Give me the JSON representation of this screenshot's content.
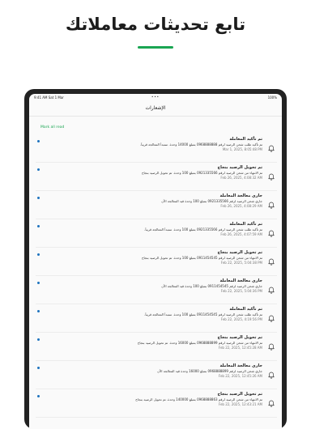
{
  "headline": "تابع تحديثات معاملاتك",
  "colors": {
    "accent": "#1aa552",
    "unread_dot": "#1e73be"
  },
  "status_bar": {
    "time": "9:41 AM",
    "date": "Sat 1 Mar",
    "dots": "•••",
    "battery": "100%"
  },
  "nav": {
    "title": "الإشعارات"
  },
  "mark_all_read": "Mark all read",
  "notifications": [
    {
      "title": "تم تأكيد المعاملة",
      "body": "تم تأكيد طلب شحن الرصيد لرقم 0968888888 بمبلغ 14000 وحدة. ستبدأ المعالجة قريباً.",
      "date": "Mar 1, 2025, 8:05:48 PM",
      "icon": "bell-icon"
    },
    {
      "title": "تم تحويل الرصيد بنجاح",
      "body": "تم الانتهاء من شحن الرصيد لرقم 0921335566 بمبلغ 100 وحدة. تم تحويل الرصيد بنجاح",
      "date": "Feb 26, 2025, 4:08:32 AM",
      "icon": "bell-icon"
    },
    {
      "title": "جاري معالجة المعاملة",
      "body": "جاري شحن الرصيد لرقم 0921335566 بمبلغ 100 وحدة قيد المعالجة الآن",
      "date": "Feb 26, 2025, 4:08:29 AM",
      "icon": "bell-icon"
    },
    {
      "title": "تم تأكيد المعاملة",
      "body": "تم تأكيد طلب شحن الرصيد لرقم 0921335566 بمبلغ 100 وحدة. ستبدأ المعالجة قريباً.",
      "date": "Feb 26, 2025, 4:07:59 AM",
      "icon": "bell-icon"
    },
    {
      "title": "تم تحويل الرصيد بنجاح",
      "body": "تم الانتهاء من شحن الرصيد لرقم 0911454545 بمبلغ 100 وحدة. تم تحويل الرصيد بنجاح",
      "date": "Feb 22, 2025, 5:04:38 PM",
      "icon": "bell-icon"
    },
    {
      "title": "جاري معالجة المعاملة",
      "body": "جاري شحن الرصيد لرقم 0911454545 بمبلغ 100 وحدة قيد المعالجة الآن",
      "date": "Feb 22, 2025, 5:04:36 PM",
      "icon": "bell-icon"
    },
    {
      "title": "تم تأكيد المعاملة",
      "body": "تم تأكيد طلب شحن الرصيد لرقم 0911454545 بمبلغ 100 وحدة. ستبدأ المعالجة قريباً.",
      "date": "Feb 22, 2025, 4:19:56 PM",
      "icon": "bell-icon"
    },
    {
      "title": "تم تحويل الرصيد بنجاح",
      "body": "تم الانتهاء من شحن الرصيد لرقم 0968888899 بمبلغ 16000 وحدة. تم تحويل الرصيد بنجاح",
      "date": "Feb 22, 2025, 12:45:28 AM",
      "icon": "bell-icon"
    },
    {
      "title": "جاري معالجة المعاملة",
      "body": "جاري شحن الرصيد لرقم 0968888899 بمبلغ 16000 وحدة قيد المعالجة الآن",
      "date": "Feb 22, 2025, 12:45:26 AM",
      "icon": "bell-icon"
    },
    {
      "title": "تم تحويل الرصيد بنجاح",
      "body": "تم الانتهاء من شحن الرصيد لرقم 0968888863 بمبلغ 140000 وحدة. تم تحويل الرصيد بنجاح",
      "date": "Feb 22, 2025, 12:43:21 AM",
      "icon": "bell-icon"
    }
  ]
}
